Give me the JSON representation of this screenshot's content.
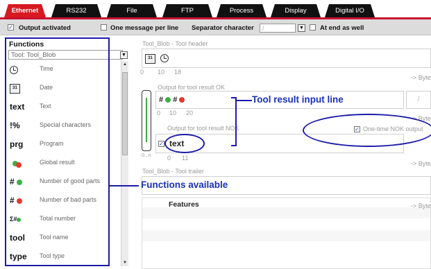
{
  "tabs": [
    {
      "label": "Ethernet",
      "active": true
    },
    {
      "label": "RS232"
    },
    {
      "label": "File"
    },
    {
      "label": "FTP"
    },
    {
      "label": "Process"
    },
    {
      "label": "Display"
    },
    {
      "label": "Digital I/O"
    }
  ],
  "options": {
    "output_activated": "Output activated",
    "one_message": "One message per line",
    "separator_label": "Separator character",
    "separator_value": "/",
    "at_end": "At end as well"
  },
  "functions": {
    "title": "Functions",
    "selected": "Tool: Tool_Blob",
    "items": [
      {
        "icon_text": "",
        "icon": "clock-icon",
        "label": "Time"
      },
      {
        "icon_text": "31",
        "icon": "calendar-icon",
        "label": "Date"
      },
      {
        "icon_text": "text",
        "icon": "text-icon",
        "label": "Text"
      },
      {
        "icon_text": "!%",
        "icon": "special-chars-icon",
        "label": "Special characters"
      },
      {
        "icon_text": "prg",
        "icon": "program-icon",
        "label": "Program"
      },
      {
        "icon_text": "",
        "icon": "global-result-icon",
        "label": "Global result"
      },
      {
        "icon_text": "#",
        "icon": "good-parts-icon",
        "label": "Number of good parts"
      },
      {
        "icon_text": "#",
        "icon": "bad-parts-icon",
        "label": "Number of bad parts"
      },
      {
        "icon_text": "Σ#",
        "icon": "total-number-icon",
        "label": "Total number"
      },
      {
        "icon_text": "tool",
        "icon": "tool-name-icon",
        "label": "Tool name"
      },
      {
        "icon_text": "type",
        "icon": "tool-type-icon",
        "label": "Tool type"
      }
    ]
  },
  "header": {
    "label": "Tool_Blob - Tool header",
    "ruler": [
      "0",
      "10",
      "18"
    ],
    "byte": "-> Byte"
  },
  "ok": {
    "label": "Output for tool result OK",
    "ruler": [
      "0",
      "10",
      "20"
    ],
    "sep": "/",
    "byte": "-> Byte"
  },
  "nok": {
    "label": "Output for tool result NOK",
    "value": "text",
    "ruler": [
      "0",
      "11"
    ],
    "onetime": "One-time NOK output",
    "byte": "-> Byte",
    "range": "0...n"
  },
  "trailer": {
    "label": "Tool_Blob - Tool trailer",
    "byte": "-> Byte"
  },
  "features": {
    "label": "Features",
    "byte": "-> Byte"
  },
  "annotations": {
    "input_line": "Tool result input line",
    "functions": "Functions available"
  },
  "colors": {
    "accent": "#d71920",
    "annotation": "#1730b8",
    "good": "#3cb043",
    "bad": "#e23a2e"
  }
}
